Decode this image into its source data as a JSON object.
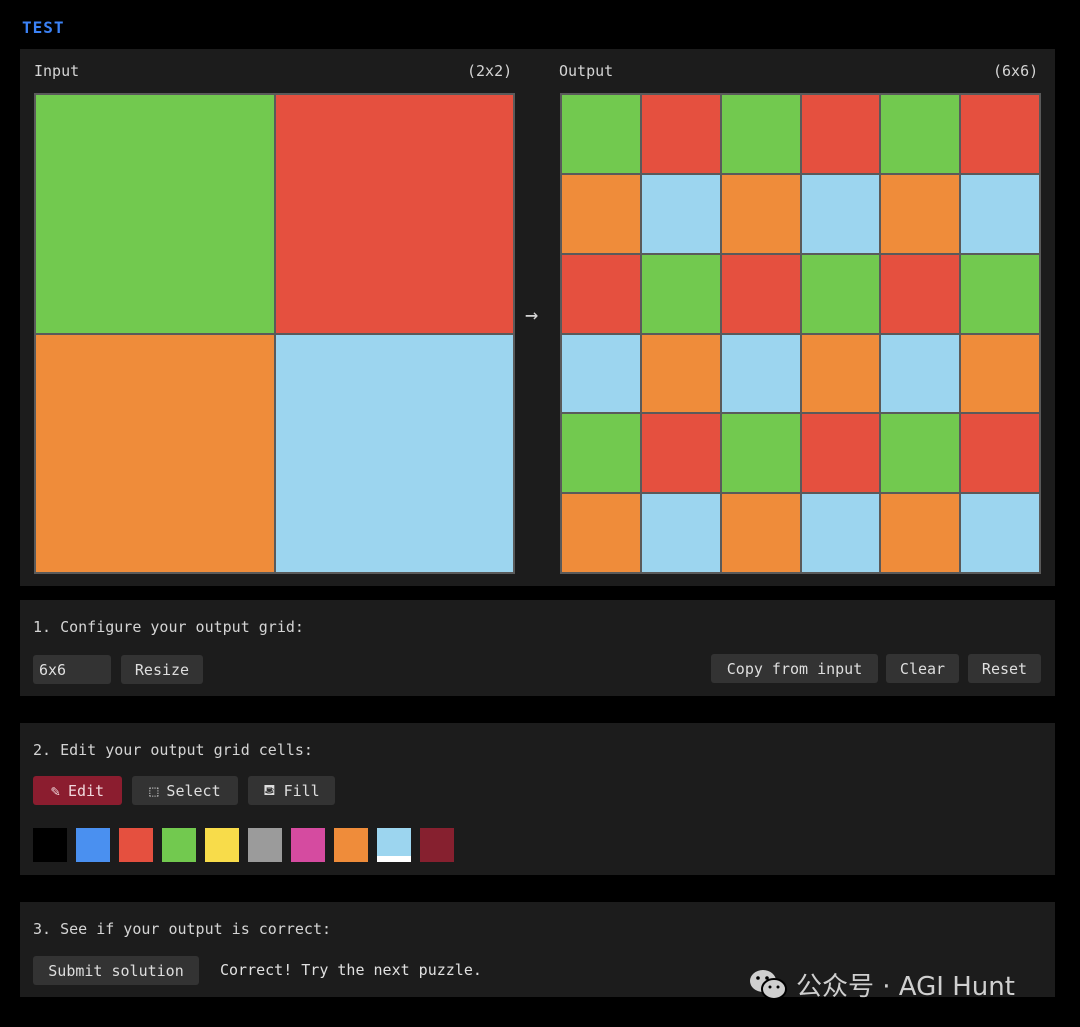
{
  "section_label": "TEST",
  "input": {
    "title": "Input",
    "size": "(2x2)",
    "cells": [
      "#72c94f",
      "#e5503f",
      "#ef8c3a",
      "#9cd5ef"
    ]
  },
  "arrow": "→",
  "output": {
    "title": "Output",
    "size": "(6x6)",
    "cells": [
      "#72c94f",
      "#e5503f",
      "#72c94f",
      "#e5503f",
      "#72c94f",
      "#e5503f",
      "#ef8c3a",
      "#9cd5ef",
      "#ef8c3a",
      "#9cd5ef",
      "#ef8c3a",
      "#9cd5ef",
      "#e5503f",
      "#72c94f",
      "#e5503f",
      "#72c94f",
      "#e5503f",
      "#72c94f",
      "#9cd5ef",
      "#ef8c3a",
      "#9cd5ef",
      "#ef8c3a",
      "#9cd5ef",
      "#ef8c3a",
      "#72c94f",
      "#e5503f",
      "#72c94f",
      "#e5503f",
      "#72c94f",
      "#e5503f",
      "#ef8c3a",
      "#9cd5ef",
      "#ef8c3a",
      "#9cd5ef",
      "#ef8c3a",
      "#9cd5ef"
    ]
  },
  "configure": {
    "title": "1. Configure your output grid:",
    "size_value": "6x6",
    "resize_label": "Resize",
    "copy_label": "Copy from input",
    "clear_label": "Clear",
    "reset_label": "Reset"
  },
  "edit": {
    "title": "2. Edit your output grid cells:",
    "tools": [
      {
        "label": "Edit",
        "icon": "pencil-icon",
        "glyph": "✎",
        "active": true
      },
      {
        "label": "Select",
        "icon": "select-icon",
        "glyph": "⬚",
        "active": false
      },
      {
        "label": "Fill",
        "icon": "fill-icon",
        "glyph": "⛾",
        "active": false
      }
    ],
    "palette": [
      "#000000",
      "#4a90f0",
      "#e5503f",
      "#72c94f",
      "#f8dc4a",
      "#9b9b9b",
      "#d54ba0",
      "#ef8c3a",
      "#9cd5ef",
      "#86202f"
    ],
    "selected_color": "#9cd5ef"
  },
  "check": {
    "title": "3. See if your output is correct:",
    "submit_label": "Submit solution",
    "status": "Correct! Try the next puzzle."
  },
  "watermark": {
    "text": "公众号 · AGI Hunt",
    "icon": "wechat-icon"
  }
}
